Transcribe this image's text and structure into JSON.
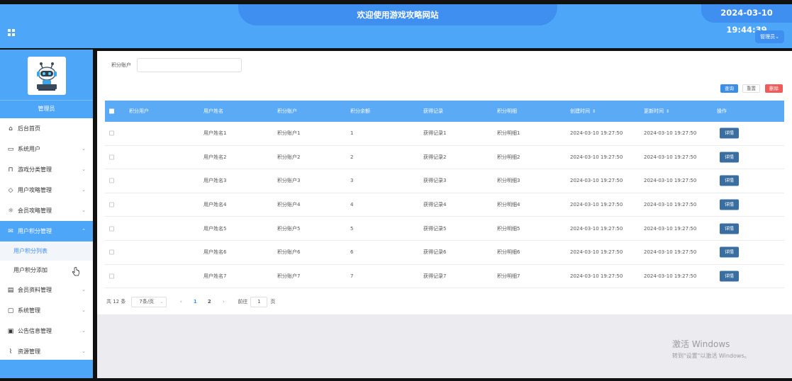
{
  "header": {
    "title": "欢迎使用游戏攻略网站",
    "datetime": "2024-03-10 19:44:39",
    "admin_menu": "管理员⌄",
    "grid_icon": "grid-icon"
  },
  "sidebar": {
    "role": "管理员",
    "items": [
      {
        "label": "后台首页",
        "icon": "home-icon",
        "arrow": ""
      },
      {
        "label": "系统用户",
        "icon": "monitor-icon",
        "arrow": "⌄"
      },
      {
        "label": "游戏分类管理",
        "icon": "bookmark-icon",
        "arrow": "⌄"
      },
      {
        "label": "用户攻略管理",
        "icon": "tag-icon",
        "arrow": "⌄"
      },
      {
        "label": "会员攻略管理",
        "icon": "sun-icon",
        "arrow": "⌄"
      },
      {
        "label": "用户积分管理",
        "icon": "mail-icon",
        "arrow": "⌃"
      },
      {
        "label": "会员资料管理",
        "icon": "clipboard-icon",
        "arrow": "⌄"
      },
      {
        "label": "系统管理",
        "icon": "chat-icon",
        "arrow": "⌄"
      },
      {
        "label": "公告信息管理",
        "icon": "box-icon",
        "arrow": "⌄"
      },
      {
        "label": "资源管理",
        "icon": "paperclip-icon",
        "arrow": "⌄"
      }
    ],
    "sub_items": [
      {
        "label": "用户积分列表"
      },
      {
        "label": "用户积分添加"
      }
    ]
  },
  "search": {
    "label": "积分账户",
    "value": ""
  },
  "actions": {
    "query": "查询",
    "reset": "重置",
    "delete": "删除"
  },
  "table": {
    "headers": [
      "积分用户",
      "用户姓名",
      "积分账户",
      "积分余额",
      "获得记录",
      "积分明细",
      "创建时间",
      "更新时间",
      "操作"
    ],
    "sort_glyph": "⇕",
    "detail_label": "详情",
    "rows": [
      {
        "user": "",
        "name": "用户姓名1",
        "account": "积分账户1",
        "balance": "1",
        "record": "获得记录1",
        "detail": "积分明细1",
        "created": "2024-03-10 19:27:50",
        "updated": "2024-03-10 19:27:50"
      },
      {
        "user": "",
        "name": "用户姓名2",
        "account": "积分账户2",
        "balance": "2",
        "record": "获得记录2",
        "detail": "积分明细2",
        "created": "2024-03-10 19:27:50",
        "updated": "2024-03-10 19:27:50"
      },
      {
        "user": "",
        "name": "用户姓名3",
        "account": "积分账户3",
        "balance": "3",
        "record": "获得记录3",
        "detail": "积分明细3",
        "created": "2024-03-10 19:27:50",
        "updated": "2024-03-10 19:27:50"
      },
      {
        "user": "",
        "name": "用户姓名4",
        "account": "积分账户4",
        "balance": "4",
        "record": "获得记录4",
        "detail": "积分明细4",
        "created": "2024-03-10 19:27:50",
        "updated": "2024-03-10 19:27:50"
      },
      {
        "user": "",
        "name": "用户姓名5",
        "account": "积分账户5",
        "balance": "5",
        "record": "获得记录5",
        "detail": "积分明细5",
        "created": "2024-03-10 19:27:50",
        "updated": "2024-03-10 19:27:50"
      },
      {
        "user": "",
        "name": "用户姓名6",
        "account": "积分账户6",
        "balance": "6",
        "record": "获得记录6",
        "detail": "积分明细6",
        "created": "2024-03-10 19:27:50",
        "updated": "2024-03-10 19:27:50"
      },
      {
        "user": "",
        "name": "用户姓名7",
        "account": "积分账户7",
        "balance": "7",
        "record": "获得记录7",
        "detail": "积分明细7",
        "created": "2024-03-10 19:27:50",
        "updated": "2024-03-10 19:27:50"
      }
    ]
  },
  "pagination": {
    "total": "共 12 条",
    "page_size": "7条/页",
    "dropdown": "⌄",
    "prev": "‹",
    "next": "›",
    "pages": [
      "1",
      "2"
    ],
    "goto_label": "前往",
    "goto_value": "1",
    "page_unit": "页"
  },
  "watermark": {
    "line1": "激活 Windows",
    "line2": "转到\"设置\"以激活 Windows。"
  }
}
